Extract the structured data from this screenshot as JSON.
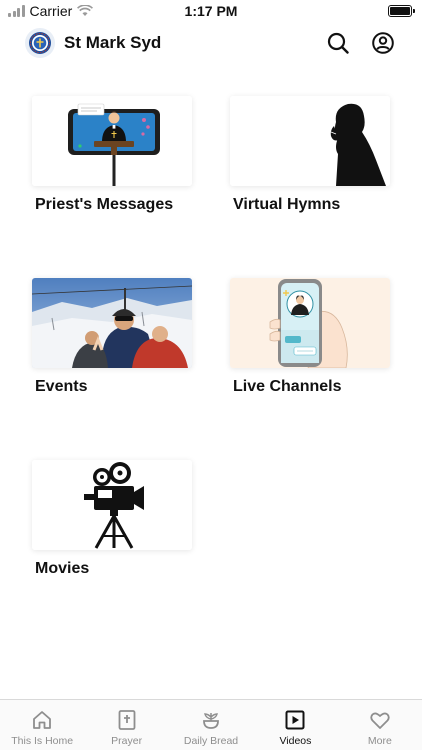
{
  "status_bar": {
    "carrier": "Carrier",
    "time": "1:17 PM"
  },
  "header": {
    "title": "St Mark Syd",
    "logo_icon": "church-emblem-icon",
    "search_icon": "search-icon",
    "profile_icon": "user-profile-icon"
  },
  "tiles": [
    {
      "label": "Priest's Messages",
      "image": "priest-on-phone-screen-illustration"
    },
    {
      "label": "Virtual Hymns",
      "image": "praying-silhouette-illustration"
    },
    {
      "label": "Events",
      "image": "ski-lift-group-selfie-photo"
    },
    {
      "label": "Live Channels",
      "image": "hand-holding-phone-live-priest-illustration"
    },
    {
      "label": "Movies",
      "image": "film-camera-illustration"
    }
  ],
  "tab_bar": {
    "active": "Videos",
    "tabs": [
      {
        "label": "This Is Home",
        "icon": "home-icon"
      },
      {
        "label": "Prayer",
        "icon": "bible-icon"
      },
      {
        "label": "Daily Bread",
        "icon": "wheat-icon"
      },
      {
        "label": "Videos",
        "icon": "play-video-icon"
      },
      {
        "label": "More",
        "icon": "heart-icon"
      }
    ]
  },
  "colors": {
    "text": "#111111",
    "inactive_tab": "#8e8e8e",
    "background": "#ffffff"
  }
}
